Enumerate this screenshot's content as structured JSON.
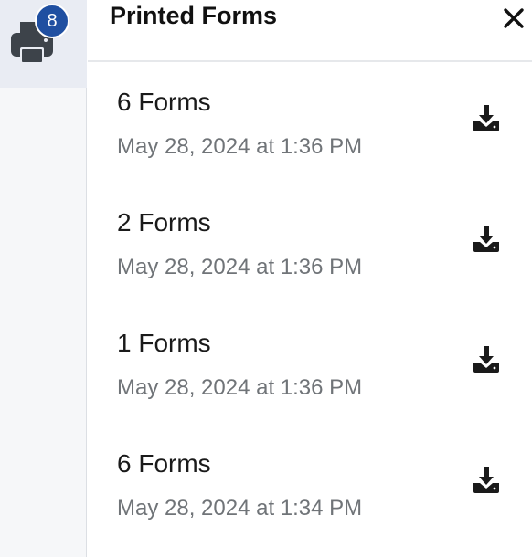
{
  "rail": {
    "printer_icon": "printer-icon",
    "badge_count": "8"
  },
  "panel": {
    "title": "Printed Forms",
    "close_icon": "close-icon"
  },
  "items": [
    {
      "title": "6 Forms",
      "date": "May 28, 2024 at 1:36 PM",
      "icon": "download-icon"
    },
    {
      "title": "2 Forms",
      "date": "May 28, 2024 at 1:36 PM",
      "icon": "download-icon"
    },
    {
      "title": "1 Forms",
      "date": "May 28, 2024 at 1:36 PM",
      "icon": "download-icon"
    },
    {
      "title": "6 Forms",
      "date": "May 28, 2024 at 1:34 PM",
      "icon": "download-icon"
    }
  ],
  "colors": {
    "badge": "#1f4fa1",
    "icon": "#3d434a",
    "text": "#1a1a1a",
    "subtext": "#707478",
    "rail": "#f6f7f9",
    "rail_active": "#e9ecf3"
  }
}
